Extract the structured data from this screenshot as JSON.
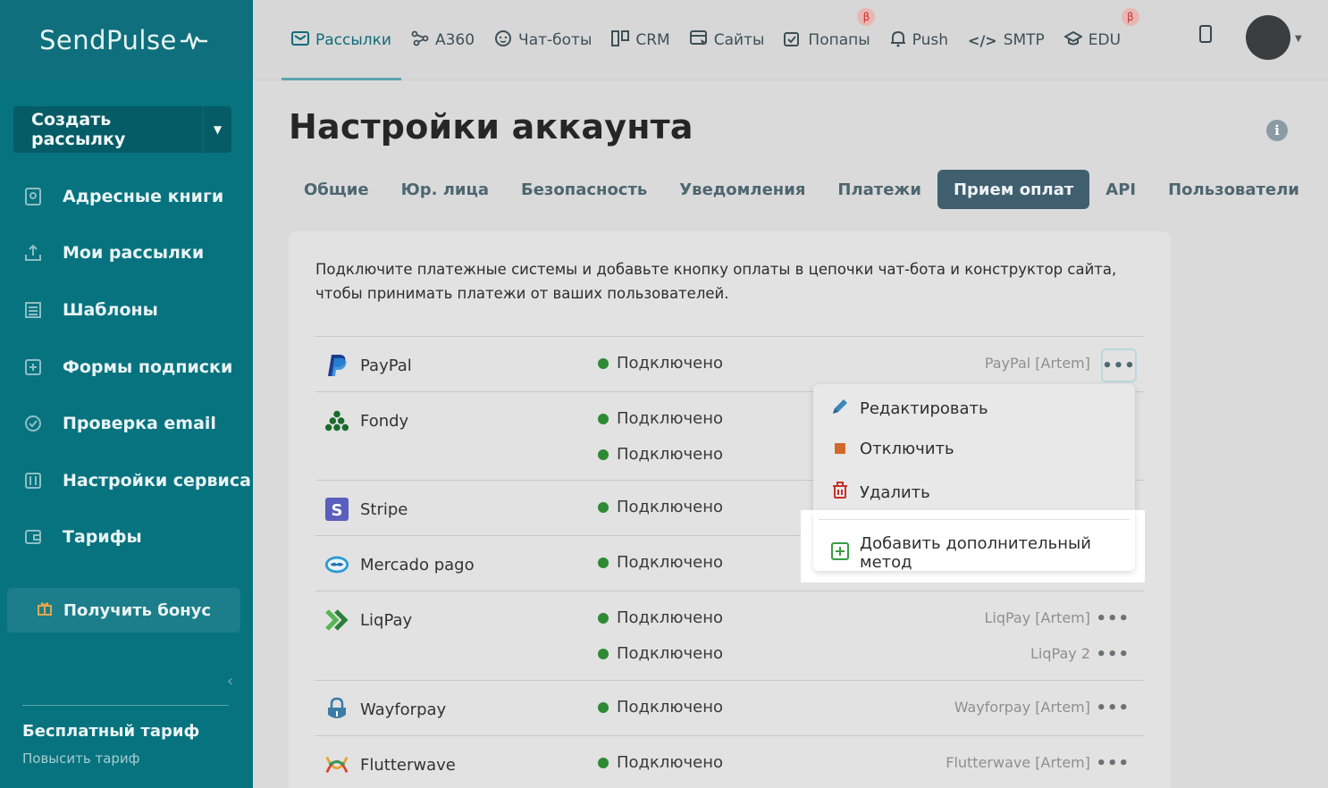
{
  "sidebar": {
    "logo": "SendPulse",
    "create_button": "Создать рассылку",
    "items": [
      {
        "label": "Адресные книги",
        "icon": "address-book-icon"
      },
      {
        "label": "Мои рассылки",
        "icon": "mailing-icon"
      },
      {
        "label": "Шаблоны",
        "icon": "templates-icon"
      },
      {
        "label": "Формы подписки",
        "icon": "forms-icon"
      },
      {
        "label": "Проверка email",
        "icon": "check-icon"
      },
      {
        "label": "Настройки сервиса",
        "icon": "settings-icon"
      },
      {
        "label": "Тарифы",
        "icon": "wallet-icon"
      }
    ],
    "bonus_button": "Получить бонус",
    "plan_name": "Бесплатный тариф",
    "plan_upgrade": "Повысить тариф"
  },
  "topnav": [
    {
      "label": "Рассылки",
      "icon": "mail-icon",
      "active": true
    },
    {
      "label": "A360",
      "icon": "a360-icon"
    },
    {
      "label": "Чат-боты",
      "icon": "chatbot-icon"
    },
    {
      "label": "CRM",
      "icon": "crm-icon"
    },
    {
      "label": "Сайты",
      "icon": "sites-icon"
    },
    {
      "label": "Попапы",
      "icon": "popups-icon",
      "beta": "β"
    },
    {
      "label": "Push",
      "icon": "bell-icon"
    },
    {
      "label": "SMTP",
      "icon": "code-icon"
    },
    {
      "label": "EDU",
      "icon": "edu-icon",
      "beta": "β"
    }
  ],
  "page": {
    "title": "Настройки аккаунта",
    "tabs": [
      "Общие",
      "Юр. лица",
      "Безопасность",
      "Уведомления",
      "Платежи",
      "Прием оплат",
      "API",
      "Пользователи"
    ],
    "active_tab": "Прием оплат",
    "intro": "Подключите платежные системы и добавьте кнопку оплаты в цепочки чат-бота и конструктор сайта, чтобы принимать платежи от ваших пользователей."
  },
  "providers": [
    {
      "name": "PayPal",
      "subs": [
        {
          "status": "Подключено",
          "account": "PayPal [Artem]"
        }
      ]
    },
    {
      "name": "Fondy",
      "subs": [
        {
          "status": "Подключено",
          "account": ""
        },
        {
          "status": "Подключено",
          "account": ""
        }
      ]
    },
    {
      "name": "Stripe",
      "subs": [
        {
          "status": "Подключено",
          "account": ""
        }
      ]
    },
    {
      "name": "Mercado pago",
      "subs": [
        {
          "status": "Подключено",
          "account": ""
        }
      ]
    },
    {
      "name": "LiqPay",
      "subs": [
        {
          "status": "Подключено",
          "account": "LiqPay [Artem]"
        },
        {
          "status": "Подключено",
          "account": "LiqPay 2"
        }
      ]
    },
    {
      "name": "Wayforpay",
      "subs": [
        {
          "status": "Подключено",
          "account": "Wayforpay [Artem]"
        }
      ]
    },
    {
      "name": "Flutterwave",
      "subs": [
        {
          "status": "Подключено",
          "account": "Flutterwave [Artem]"
        }
      ]
    }
  ],
  "menu": {
    "edit": "Редактировать",
    "disable": "Отключить",
    "delete": "Удалить",
    "add_method": "Добавить дополнительный метод"
  },
  "colors": {
    "sidebar": "#06737f",
    "accent": "#116b7a",
    "status_green": "#2e8a35",
    "tab_active": "#3f5f6e"
  }
}
